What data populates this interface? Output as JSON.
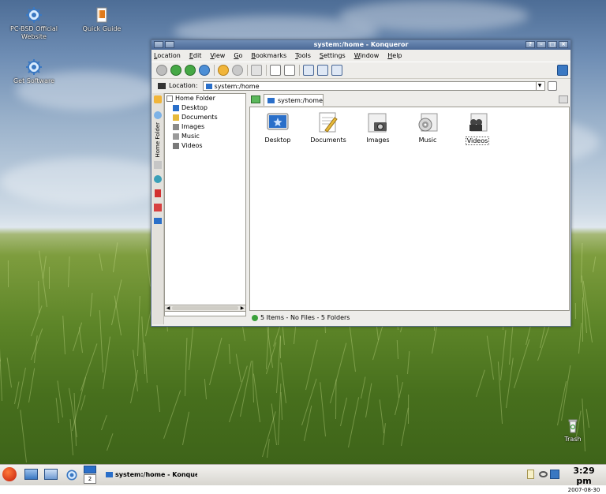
{
  "desktop": {
    "icons": [
      {
        "label_line1": "PC-BSD Official",
        "label_line2": "Website"
      },
      {
        "label_line1": "Quick Guide",
        "label_line2": ""
      },
      {
        "label_line1": "Get Software",
        "label_line2": ""
      },
      {
        "label_line1": "Trash",
        "label_line2": ""
      }
    ]
  },
  "window": {
    "title": "system:/home - Konqueror",
    "menu": [
      "Location",
      "Edit",
      "View",
      "Go",
      "Bookmarks",
      "Tools",
      "Settings",
      "Window",
      "Help"
    ],
    "location_label": "Location:",
    "location_value": "system:/home",
    "sidebar_tab": "Home Folder",
    "tree_root": "Home Folder",
    "tree_items": [
      "Desktop",
      "Documents",
      "Images",
      "Music",
      "Videos"
    ],
    "tab_label": "system:/home",
    "items": [
      {
        "label": "Desktop",
        "icon": "desktop-folder-icon",
        "color": "#2a6fc9"
      },
      {
        "label": "Documents",
        "icon": "documents-folder-icon",
        "color": "#e6b93a"
      },
      {
        "label": "Images",
        "icon": "images-folder-icon",
        "color": "#8a8a8a"
      },
      {
        "label": "Music",
        "icon": "music-folder-icon",
        "color": "#9a9a9a"
      },
      {
        "label": "Videos",
        "icon": "videos-folder-icon",
        "color": "#7a7a7a"
      }
    ],
    "status": "5 Items - No Files - 5 Folders"
  },
  "taskbar": {
    "desktop_number": "2",
    "task_label": "system:/home - Konque",
    "clock_time": "3:29 pm",
    "clock_date": "2007-08-30"
  }
}
